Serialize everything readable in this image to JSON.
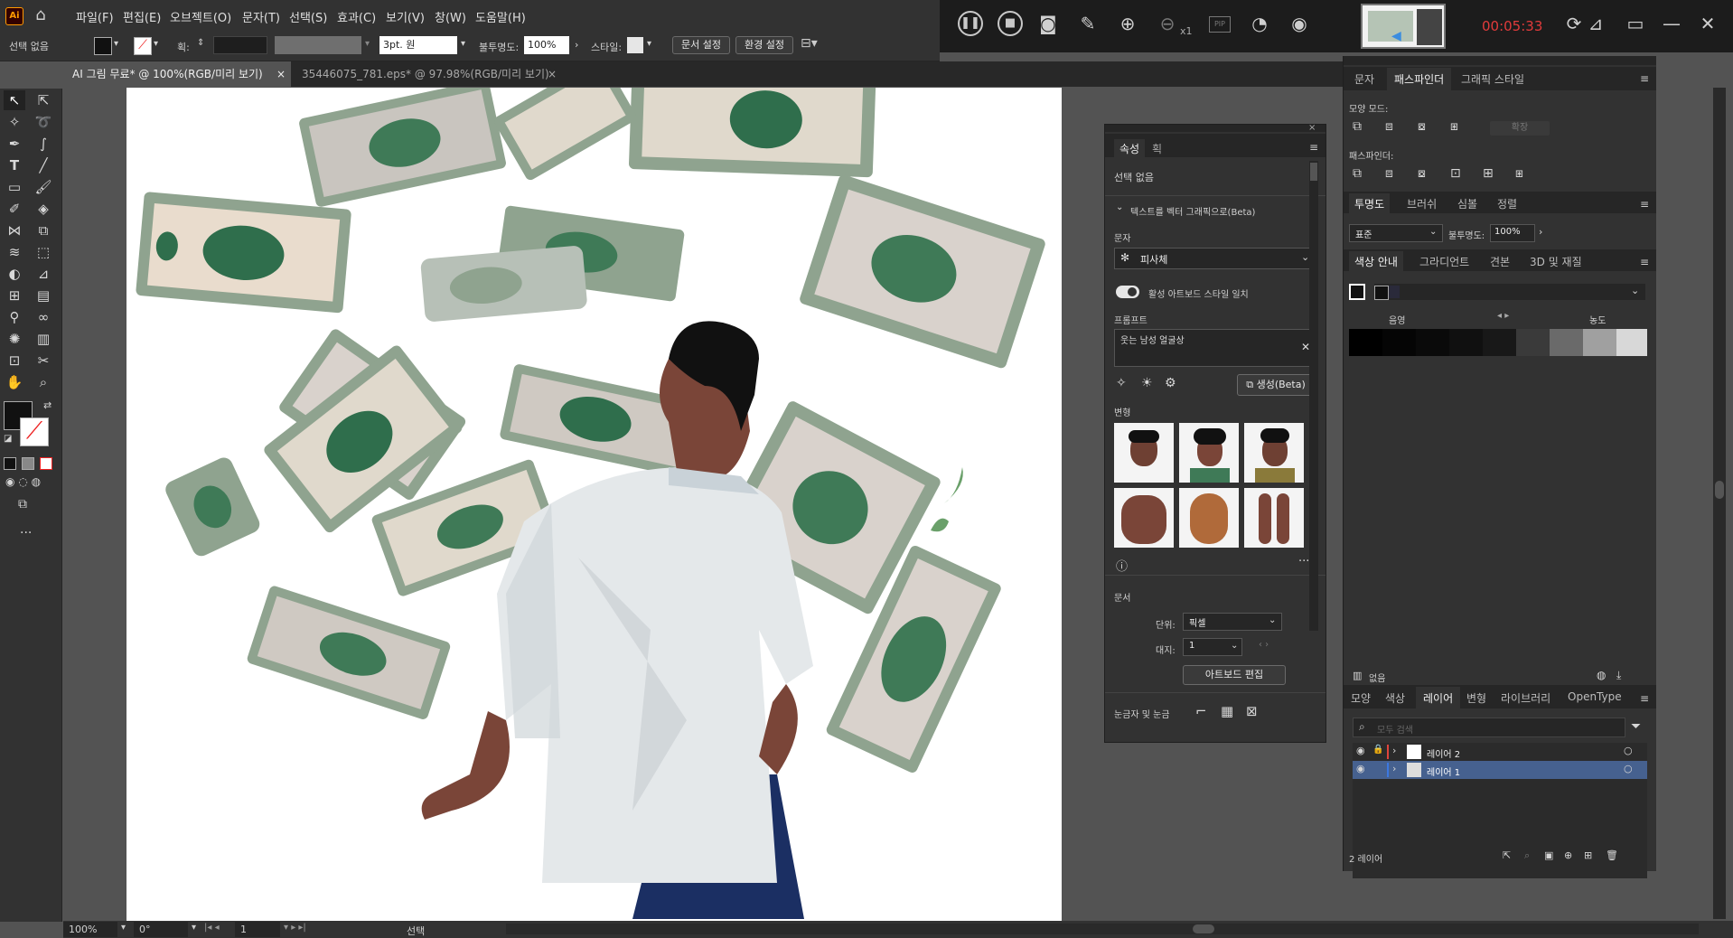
{
  "app": {
    "logo": "Ai",
    "home_icon": "home-icon"
  },
  "menu": [
    "파일(F)",
    "편집(E)",
    "오브젝트(O)",
    "문자(T)",
    "선택(S)",
    "효과(C)",
    "보기(V)",
    "창(W)",
    "도움말(H)"
  ],
  "recorder": {
    "time": "00:05:33",
    "zoom_suffix": "x1",
    "pip_label": "PIP"
  },
  "control": {
    "selection_label": "선택 없음",
    "stroke_label": "획:",
    "brush_value": "3pt. 원",
    "opacity_label": "불투명도:",
    "opacity_value": "100%",
    "style_label": "스타일:",
    "doc_setup": "문서 설정",
    "preferences": "환경 설정"
  },
  "tabs": [
    {
      "label": "AI 그림 무료* @ 100%(RGB/미리 보기)",
      "close": "×"
    },
    {
      "label": "35446075_781.eps* @ 97.98%(RGB/미리 보기)",
      "close": "×"
    }
  ],
  "status": {
    "zoom": "100%",
    "rotation": "0°",
    "artboard": "1",
    "tool": "선택"
  },
  "properties": {
    "tabs": [
      "속성",
      "획"
    ],
    "no_selection": "선택 없음",
    "section_vector": "텍스트를 벡터 그래픽으로(Beta)",
    "subject_label": "문자",
    "subject_value": "피사체",
    "toggle_label": "활성 아트보드 스타일 일치",
    "prompt_label": "프롬프트",
    "prompt_value": "웃는 남성 얼굴상",
    "generate_label": "생성(Beta)",
    "variations_label": "변형",
    "doc_label": "문서",
    "units_label": "단위:",
    "units_value": "픽셀",
    "artboard_label": "대지:",
    "artboard_value": "1",
    "edit_artboard": "아트보드 편집",
    "rulers_label": "눈금자 및 눈금"
  },
  "dock": {
    "top_tabs": [
      "문자",
      "패스파인더",
      "그래픽 스타일"
    ],
    "shape_modes": "모양 모드:",
    "expand": "확장",
    "pathfinders": "패스파인더:",
    "transparency_tabs": [
      "투명도",
      "브러쉬",
      "심볼",
      "정렬"
    ],
    "blend_mode": "표준",
    "opacity_label": "불투명도:",
    "opacity_value": "100%",
    "color_guide_tabs": [
      "색상 안내",
      "그라디언트",
      "견본",
      "3D 및 재질"
    ],
    "shade_label": "음영",
    "tint_label": "농도",
    "none_label": "없음",
    "layers_tabs": [
      "모양",
      "색상",
      "레이어",
      "변형",
      "라이브러리",
      "OpenType"
    ],
    "search_placeholder": "모두 검색",
    "layers": [
      {
        "name": "레이어 2",
        "color": "#e0443c"
      },
      {
        "name": "레이어 1",
        "color": "#3c78e0"
      }
    ],
    "layer_count": "2 레이어"
  },
  "colors": {
    "accent": "#4b6fb0",
    "timer": "#e23b3b",
    "bill_green": "#8fa38f",
    "skin": "#7a4538",
    "shirt": "#e4e8ea"
  }
}
